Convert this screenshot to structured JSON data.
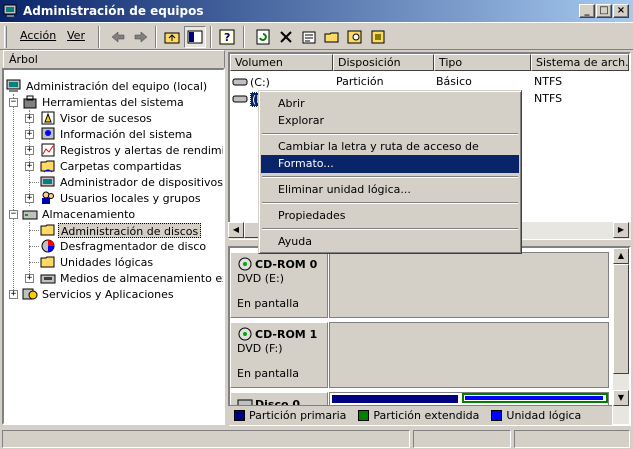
{
  "window": {
    "title": "Administración de equipos"
  },
  "menu": {
    "accion": "Acción",
    "ver": "Ver"
  },
  "left_tab": "Árbol",
  "tree": {
    "root": "Administración del equipo (local)",
    "herramientas": "Herramientas del sistema",
    "visor": "Visor de sucesos",
    "informacion": "Información del sistema",
    "registros": "Registros y alertas de rendimiento",
    "carpetas": "Carpetas compartidas",
    "admin_disp": "Administrador de dispositivos",
    "usuarios": "Usuarios locales y grupos",
    "almacenamiento": "Almacenamiento",
    "admin_discos": "Administración de discos",
    "desfrag": "Desfragmentador de disco",
    "unidades": "Unidades lógicas",
    "medios": "Medios de almacenamiento extraíbles",
    "servicios": "Servicios y Aplicaciones"
  },
  "volume_table": {
    "columns": [
      "Volumen",
      "Disposición",
      "Tipo",
      "Sistema de arch..."
    ],
    "rows": [
      {
        "volumen": "(C:)",
        "disposicion": "Partición",
        "tipo": "Básico",
        "sistema": "NTFS"
      },
      {
        "volumen": "(I",
        "disposicion": "",
        "tipo": "",
        "sistema": "NTFS"
      }
    ]
  },
  "context_menu": {
    "abrir": "Abrir",
    "explorar": "Explorar",
    "cambiar": "Cambiar la letra y ruta de acceso de unidad...",
    "formato": "Formato...",
    "eliminar": "Eliminar unidad lógica...",
    "propiedades": "Propiedades",
    "ayuda": "Ayuda"
  },
  "disks": [
    {
      "name": "CD-ROM 0",
      "type": "DVD (E:)",
      "status": "En pantalla"
    },
    {
      "name": "CD-ROM 1",
      "type": "DVD (F:)",
      "status": "En pantalla"
    },
    {
      "name": "Disco 0",
      "type": "",
      "status": ""
    }
  ],
  "legend": {
    "primaria": "Partición primaria",
    "extendida": "Partición extendida",
    "logica": "Unidad lógica",
    "colors": {
      "primaria": "#000080",
      "extendida": "#008000",
      "logica": "#0000ff"
    }
  },
  "colors": {
    "title_start": "#0a246a",
    "title_end": "#a6caf0",
    "highlight": "#0a246a"
  }
}
